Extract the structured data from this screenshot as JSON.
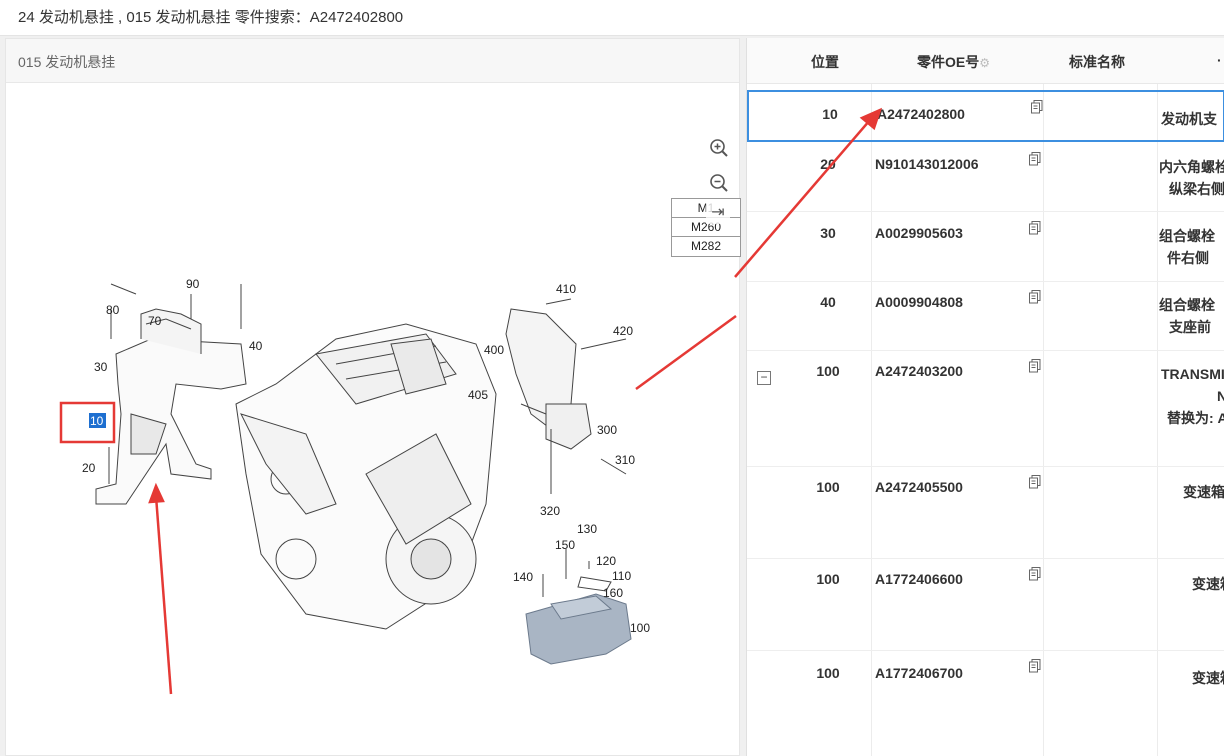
{
  "breadcrumb": "24 发动机悬挂 , 015 发动机悬挂 零件搜索：A2472402800",
  "left_panel": {
    "title": "015 发动机悬挂",
    "zoom_in_icon": "zoom-in-icon",
    "zoom_out_icon": "zoom-out-icon",
    "reset_icon": "rotate-reset-icon",
    "models": [
      "M1",
      "M260",
      "M282"
    ],
    "callouts": {
      "c10": "10",
      "c20": "20",
      "c30": "30",
      "c40": "40",
      "c70": "70",
      "c80": "80",
      "c90": "90",
      "c100": "100",
      "c110": "110",
      "c120": "120",
      "c130": "130",
      "c140": "140",
      "c150": "150",
      "c160": "160",
      "c300": "300",
      "c310": "310",
      "c320": "320",
      "c400": "400",
      "c405": "405",
      "c410": "410",
      "c420": "420"
    },
    "highlight_color": "#e53935"
  },
  "table": {
    "headers": {
      "position": "位置",
      "oe": "零件OE号",
      "std_name": "标准名称",
      "extra": "·"
    },
    "rows": [
      {
        "pos": "10",
        "oe": "A2472402800",
        "name1": "发动机支",
        "name2": ""
      },
      {
        "pos": "20",
        "oe": "N910143012006",
        "name1": "内六角螺栓",
        "name2": "纵梁右侧"
      },
      {
        "pos": "30",
        "oe": "A0029905603",
        "name1": "组合螺栓",
        "name2": "件右侧"
      },
      {
        "pos": "40",
        "oe": "A0009904808",
        "name1": "组合螺栓",
        "name2": "支座前"
      },
      {
        "pos": "100",
        "oe": "A2472403200",
        "name1": "TRANSMIS",
        "name2": "N",
        "name3": "替换为: A"
      },
      {
        "pos": "100",
        "oe": "A2472405500",
        "name1": "变速箱",
        "name2": ""
      },
      {
        "pos": "100",
        "oe": "A1772406600",
        "name1": "变速箱",
        "name2": ""
      },
      {
        "pos": "100",
        "oe": "A1772406700",
        "name1": "变速箱",
        "name2": ""
      }
    ],
    "selected_color": "#3c8fe0"
  }
}
